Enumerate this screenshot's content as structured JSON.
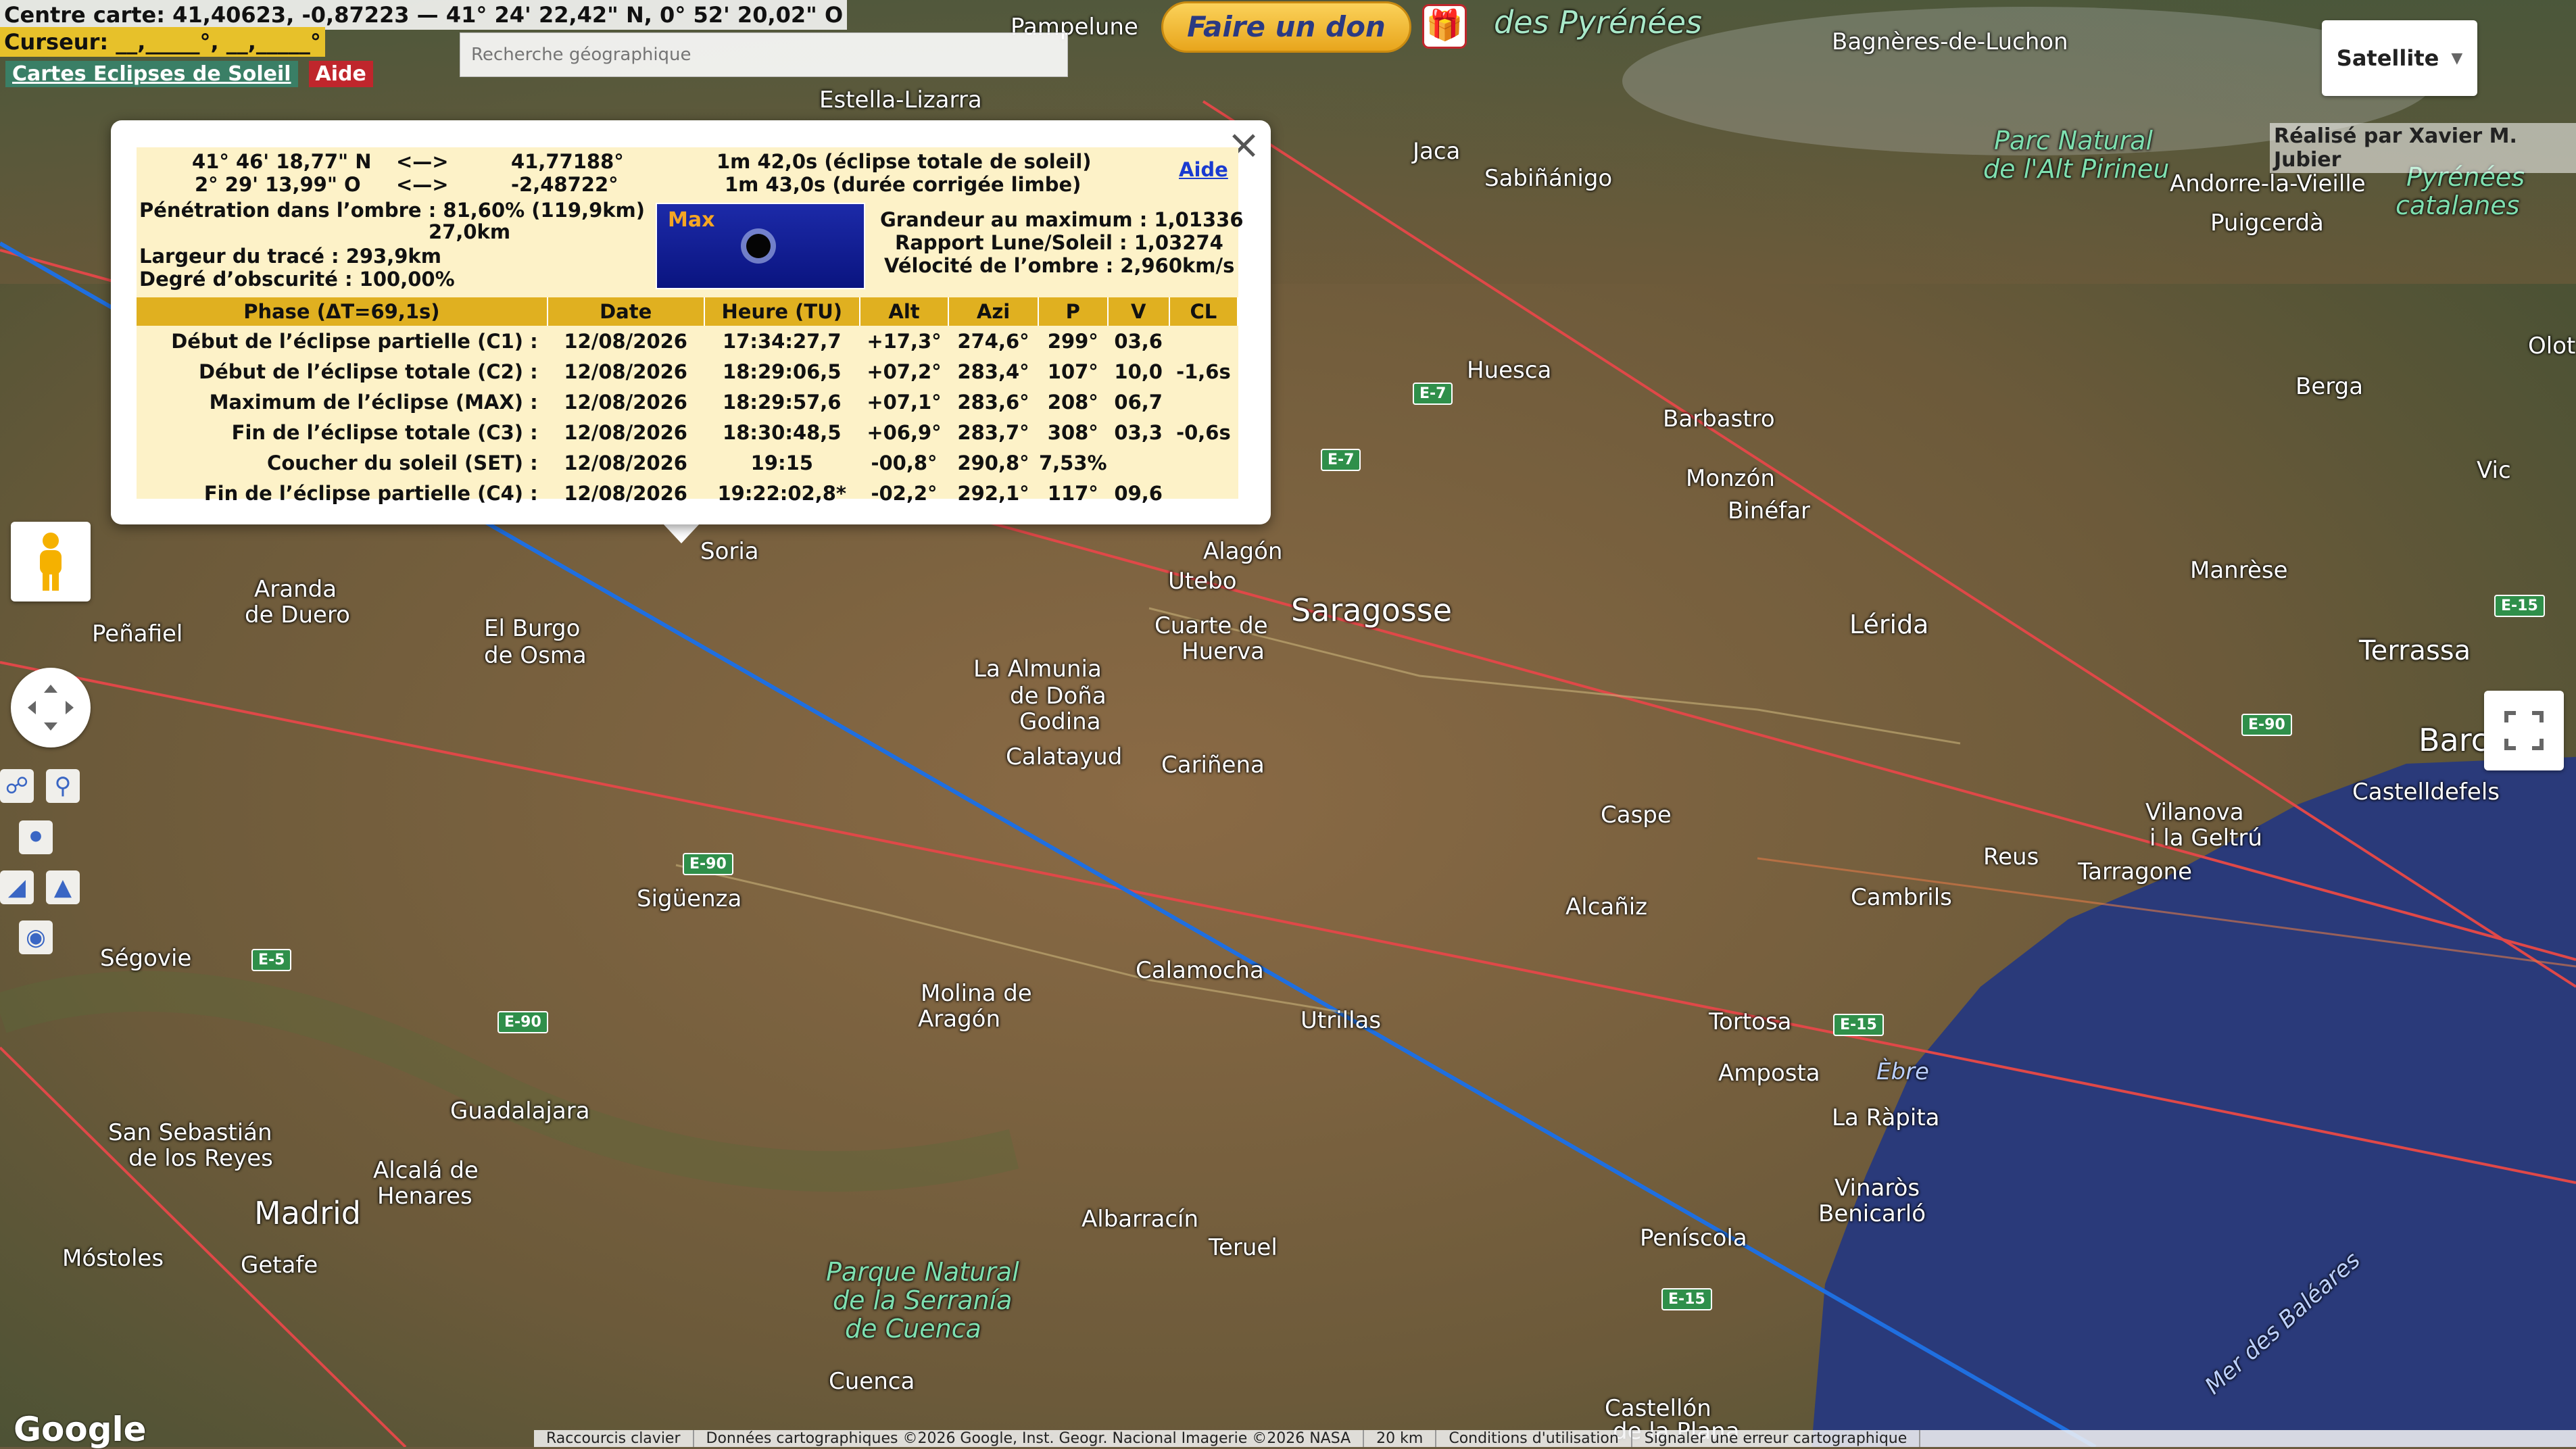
{
  "header": {
    "centre": "Centre carte: 41,40623, -0,87223 — 41° 24' 22,42\" N, 0° 52' 20,02\" O",
    "curseur": "Curseur: __,_____°, __,_____°",
    "cartes_link": "Cartes Eclipses de Soleil",
    "aide": "Aide"
  },
  "search": {
    "placeholder": "Recherche géographique"
  },
  "don": {
    "label": "Faire un don"
  },
  "maptype": {
    "label": "Satellite"
  },
  "credit": "Réalisé par Xavier M. Jubier",
  "popup": {
    "lat_dms": "41° 46' 18,77\" N",
    "lon_dms": "2° 29' 13,99\" O",
    "arrow": "<—>",
    "lat_dec": "41,77188°",
    "lon_dec": "-2,48722°",
    "duration1": "1m 42,0s (éclipse totale de soleil)",
    "duration2": "1m 43,0s (durée corrigée limbe)",
    "aide": "Aide",
    "penetration": "Pénétration dans l’ombre : 81,60% (119,9km)",
    "penetration2": "27,0km",
    "largeur": "Largeur du tracé : 293,9km",
    "obscurite": "Degré d’obscurité : 100,00%",
    "max_label": "Max",
    "grandeur": "Grandeur au maximum : 1,01336",
    "rapport": "Rapport Lune/Soleil : 1,03274",
    "velocite": "Vélocité de l’ombre : 2,960km/s",
    "headers": [
      "Phase (ΔT=69,1s)",
      "Date",
      "Heure (TU)",
      "Alt",
      "Azi",
      "P",
      "V",
      "CL"
    ],
    "rows": [
      [
        "Début de l’éclipse partielle (C1) :",
        "12/08/2026",
        "17:34:27,7",
        "+17,3°",
        "274,6°",
        "299°",
        "03,6",
        ""
      ],
      [
        "Début de l’éclipse totale (C2) :",
        "12/08/2026",
        "18:29:06,5",
        "+07,2°",
        "283,4°",
        "107°",
        "10,0",
        "-1,6s"
      ],
      [
        "Maximum de l’éclipse (MAX) :",
        "12/08/2026",
        "18:29:57,6",
        "+07,1°",
        "283,6°",
        "208°",
        "06,7",
        ""
      ],
      [
        "Fin de l’éclipse totale (C3) :",
        "12/08/2026",
        "18:30:48,5",
        "+06,9°",
        "283,7°",
        "308°",
        "03,3",
        "-0,6s"
      ],
      [
        "Coucher du soleil (SET) :",
        "12/08/2026",
        "19:15",
        "-00,8°",
        "290,8°",
        "7,53%",
        "",
        ""
      ],
      [
        "Fin de l’éclipse partielle (C4) :",
        "12/08/2026",
        "19:22:02,8*",
        "-02,2°",
        "292,1°",
        "117°",
        "09,6",
        ""
      ]
    ]
  },
  "labels": {
    "pampelune": "Pampelune",
    "pyrenees": "des Pyrénées",
    "bagneres": "Bagnères-de-Luchon",
    "estella": "Estella-Lizarra",
    "jaca": "Jaca",
    "sabinanigo": "Sabiñánigo",
    "parc1": "Parc Natural",
    "parc2": "de l'Alt Pirineu",
    "andorre": "Andorre-la-Vieille",
    "puigcerda": "Puigcerdà",
    "pyrcat1": "Pyrénées",
    "pyrcat2": "catalanes",
    "huesca": "Huesca",
    "barbastro": "Barbastro",
    "olot": "Olot",
    "berga": "Berga",
    "monzon": "Monzón",
    "binefar": "Binéfar",
    "vic": "Vic",
    "manrese": "Manrèse",
    "soria": "Soria",
    "alagon": "Alagón",
    "utebo": "Utebo",
    "saragosse": "Saragosse",
    "lerida": "Lérida",
    "terrassa": "Terrassa",
    "bar": "Barc",
    "aranda1": "Aranda",
    "aranda2": "de Duero",
    "penafiel": "Peñafiel",
    "burgo1": "El Burgo",
    "burgo2": "de Osma",
    "cuarte1": "Cuarte de",
    "cuarte2": "Huerva",
    "almunia1": "La Almunia",
    "almunia2": "de Doña",
    "almunia3": "Godina",
    "calatayud": "Calatayud",
    "carinena": "Cariñena",
    "caspe": "Caspe",
    "vilanova1": "Vilanova",
    "vilanova2": "i la Geltrú",
    "castelldefels": "Castelldefels",
    "reus": "Reus",
    "tarragone": "Tarragone",
    "cambrils": "Cambrils",
    "alcaniz": "Alcañiz",
    "siguenza": "Sigüenza",
    "segovie": "Ségovie",
    "calamocha": "Calamocha",
    "molina1": "Molina de",
    "molina2": "Aragón",
    "utrillas": "Utrillas",
    "tortosa": "Tortosa",
    "amposta": "Amposta",
    "ebre": "Èbre",
    "rapita": "La Ràpita",
    "guadalajara": "Guadalajara",
    "sansebastian1": "San Sebastián",
    "sansebastian2": "de los Reyes",
    "alcala1": "Alcalá de",
    "alcala2": "Henares",
    "madrid": "Madrid",
    "mostoles": "Móstoles",
    "getafe": "Getafe",
    "albarracin": "Albarracín",
    "teruel": "Teruel",
    "serrania1": "Parque Natural",
    "serrania2": "de la Serranía",
    "serrania3": "de Cuenca",
    "vinaros1": "Vinaròs",
    "vinaros2": "Benicarló",
    "peniscola": "Peníscola",
    "cuenca": "Cuenca",
    "castellon1": "Castellón",
    "castellon2": "de la Plana",
    "baleares": "Mer des Baléares"
  },
  "roads": {
    "e7a": "E-7",
    "e7b": "E-7",
    "e90a": "E-90",
    "e90b": "E-90",
    "e90c": "E-90",
    "e5": "E-5",
    "e15a": "E-15",
    "e15b": "E-15",
    "e15c": "E-15"
  },
  "footer": {
    "google": "Google",
    "shortcuts": "Raccourcis clavier",
    "data": "Données cartographiques ©2026 Google, Inst. Geogr. Nacional Imagerie ©2026 NASA",
    "scale": "20 km",
    "conditions": "Conditions d'utilisation",
    "signaler": "Signaler une erreur cartographique"
  },
  "colors": {
    "central_line": "#1f6fe0",
    "limit_lines": "#e04848",
    "sea": "#2a3a7a"
  }
}
